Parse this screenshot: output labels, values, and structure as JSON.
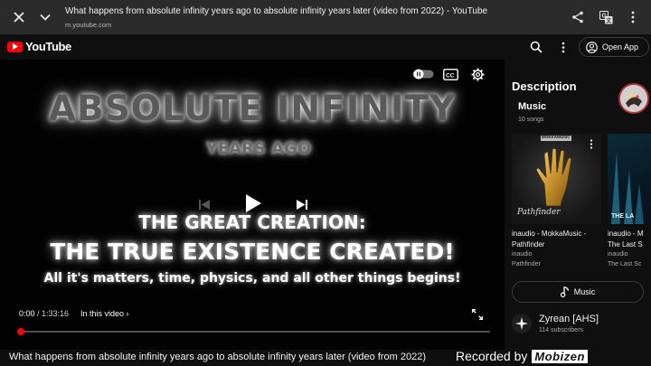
{
  "browser": {
    "title": "What happens from absolute infinity years ago to absolute infinity years later (video from 2022) - YouTube",
    "url": "m.youtube.com",
    "icons": [
      "close-icon",
      "chevron-down-icon",
      "share-icon",
      "translate-icon",
      "more-vert-icon"
    ]
  },
  "header": {
    "logo_text": "YouTube",
    "open_app_label": "Open App",
    "icons": [
      "search-icon",
      "more-vert-icon",
      "account-icon"
    ],
    "brand_color": "#ff0000"
  },
  "player": {
    "frame_text": {
      "line1": "ABSOLUTE INFINITY",
      "line2": "YEARS AGO",
      "line3": "THE GREAT CREATION:",
      "line4": "THE TRUE EXISTENCE CREATED!",
      "line5": "All it's matters, time, physics, and all other things begins!"
    },
    "current_time": "0:00",
    "duration": " / 1:33:16",
    "in_this_video": "In this video",
    "progress": 0.0,
    "controls": [
      "autoplay-toggle-icon",
      "captions-icon",
      "settings-icon",
      "previous-icon",
      "play-icon",
      "next-icon",
      "fullscreen-icon"
    ]
  },
  "video_title": "What happens from absolute infinity years ago to absolute infinity years later (video from 2022)",
  "watermark": {
    "text": "Recorded by",
    "logo": "Mobizen"
  },
  "description": {
    "title": "Description",
    "music_heading": "Music",
    "song_count": "10 songs",
    "cards": [
      {
        "album_label": "MOKKAMUSIC",
        "art_caption": "Pathfinder",
        "line1": "inaudio - MokkaMusic -",
        "line2": "Pathfinder",
        "artist": "inaudio",
        "album": "Pathfinder"
      },
      {
        "art_caption": "THE LA",
        "line1": "inaudio - M",
        "line2": "The Last S",
        "artist": "inaudio",
        "album": "The Last Sc"
      }
    ],
    "music_button": "Music",
    "channel_name": "Zyrean [AHS]",
    "subscribers": "114 subscribers"
  }
}
